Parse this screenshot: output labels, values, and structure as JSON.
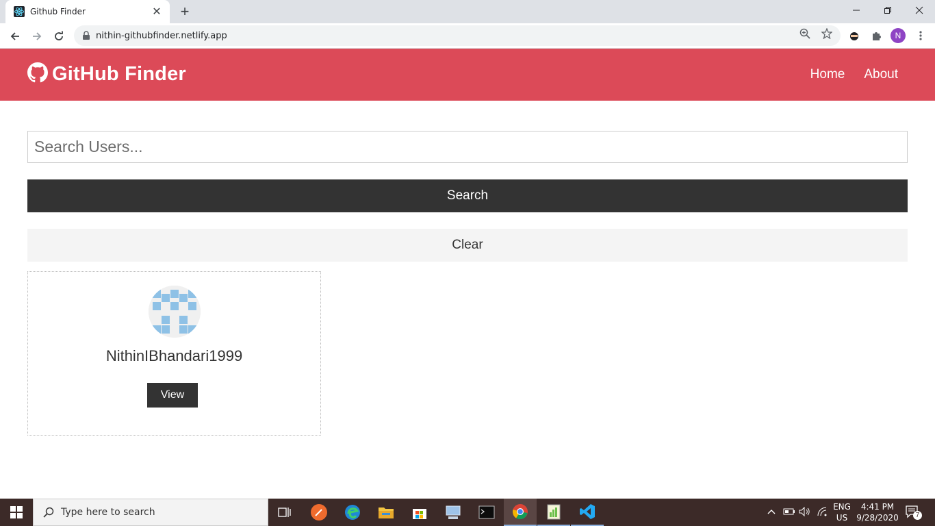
{
  "browser": {
    "tab_title": "Github Finder",
    "url": "nithin-githubfinder.netlify.app",
    "profile_initial": "N"
  },
  "navbar": {
    "brand": "GitHub Finder",
    "links": [
      {
        "label": "Home"
      },
      {
        "label": "About"
      }
    ],
    "color": "#dc4a58"
  },
  "search": {
    "placeholder": "Search Users...",
    "submit_label": "Search",
    "clear_label": "Clear"
  },
  "users": [
    {
      "login": "NithinIBhandari1999",
      "view_label": "View"
    }
  ],
  "taskbar": {
    "search_placeholder": "Type here to search",
    "lang_top": "ENG",
    "lang_bottom": "US",
    "time": "4:41 PM",
    "date": "9/28/2020",
    "notification_count": "7"
  }
}
